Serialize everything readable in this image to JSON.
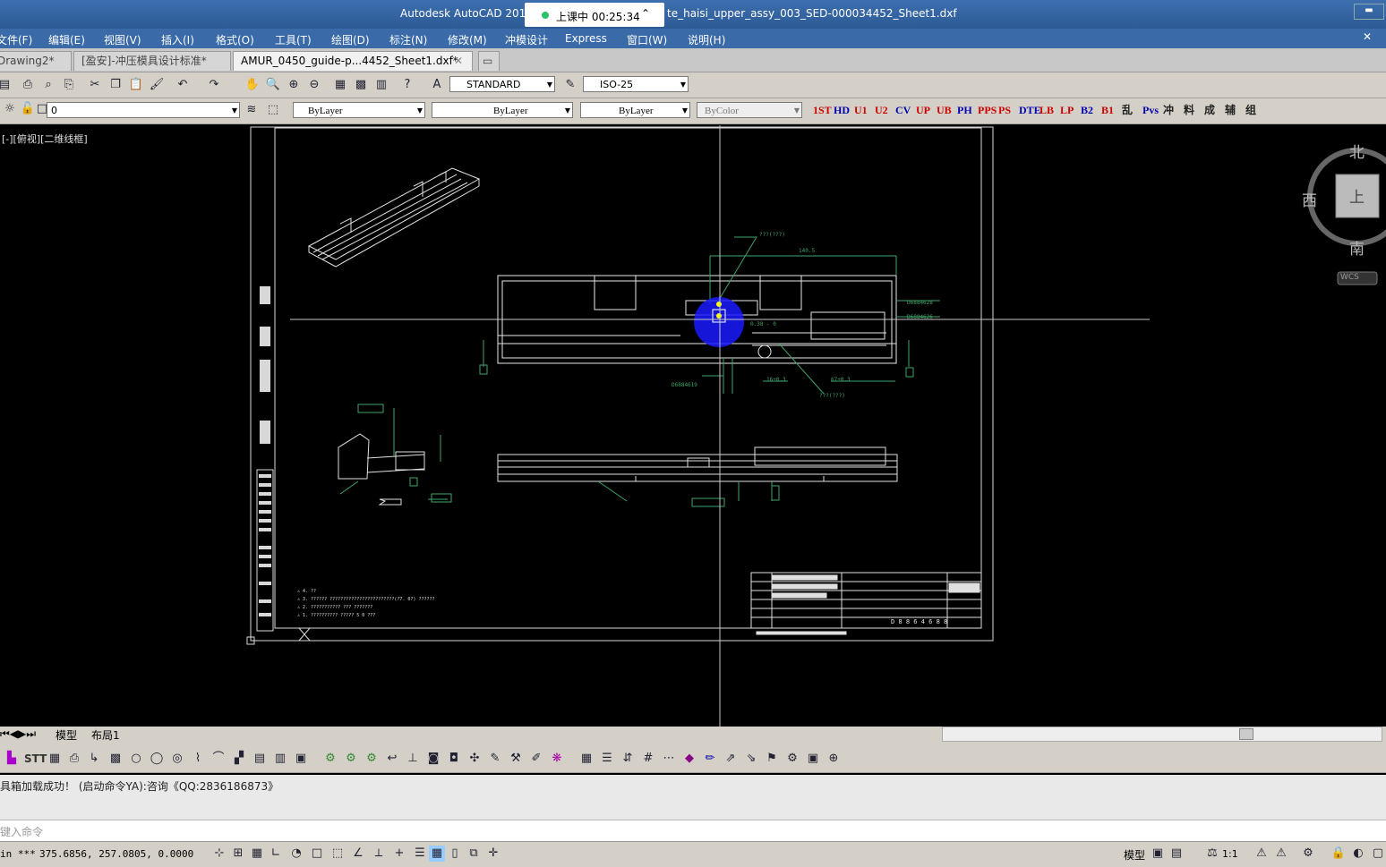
{
  "window": {
    "title_left": "Autodesk AutoCAD 2014",
    "title_right": "te_haisi_upper_assy_003_SED-000034452_Sheet1.dxf",
    "class_status": "上课中 00:25:34"
  },
  "menu": [
    "文件(F)",
    "编辑(E)",
    "视图(V)",
    "插入(I)",
    "格式(O)",
    "工具(T)",
    "绘图(D)",
    "标注(N)",
    "修改(M)",
    "冲模设计",
    "Express",
    "窗口(W)",
    "说明(H)"
  ],
  "tabs": [
    "Drawing2*",
    "[盈安]-冲压模具设计标准*",
    "AMUR_0450_guide-p...4452_Sheet1.dxf*"
  ],
  "toolbar1": {
    "text_style": "STANDARD",
    "dim_style": "ISO-25"
  },
  "toolbar2": {
    "layer": "0",
    "color": "ByLayer",
    "linetype": "ByLayer",
    "lineweight": "ByLayer",
    "plotstyle": "ByColor",
    "custom_buttons": [
      "1ST",
      "HD",
      "U1",
      "U2",
      "CV",
      "UP",
      "UB",
      "PH",
      "PPS",
      "PS",
      "DTE",
      "LB",
      "LP",
      "B2",
      "B1",
      "乱",
      "Pvs",
      "冲",
      "料",
      "成",
      "辅",
      "组"
    ]
  },
  "viewport": {
    "label": "[-][俯视][二维线框]",
    "cube": {
      "north": "北",
      "west": "西",
      "south": "南",
      "face": "上",
      "wcs": "WCS"
    }
  },
  "layout_tabs": [
    "模型",
    "布局1"
  ],
  "toolbar3_label": "STT",
  "command": {
    "history": "具箱加载成功！ (启动命令YA):咨询《QQ:2836186873》",
    "prompt": "键入命令"
  },
  "status": {
    "coords": "375.6856,  257.0805,  0.0000",
    "coords_prefix": "in ***",
    "model_label": "模型",
    "scale": "1:1"
  },
  "colors": {
    "title_bg": "#2f5e9c",
    "canvas_bg": "#000000",
    "cursor_highlight": "#1a1aff",
    "dim_lines": "#3fa36a"
  }
}
